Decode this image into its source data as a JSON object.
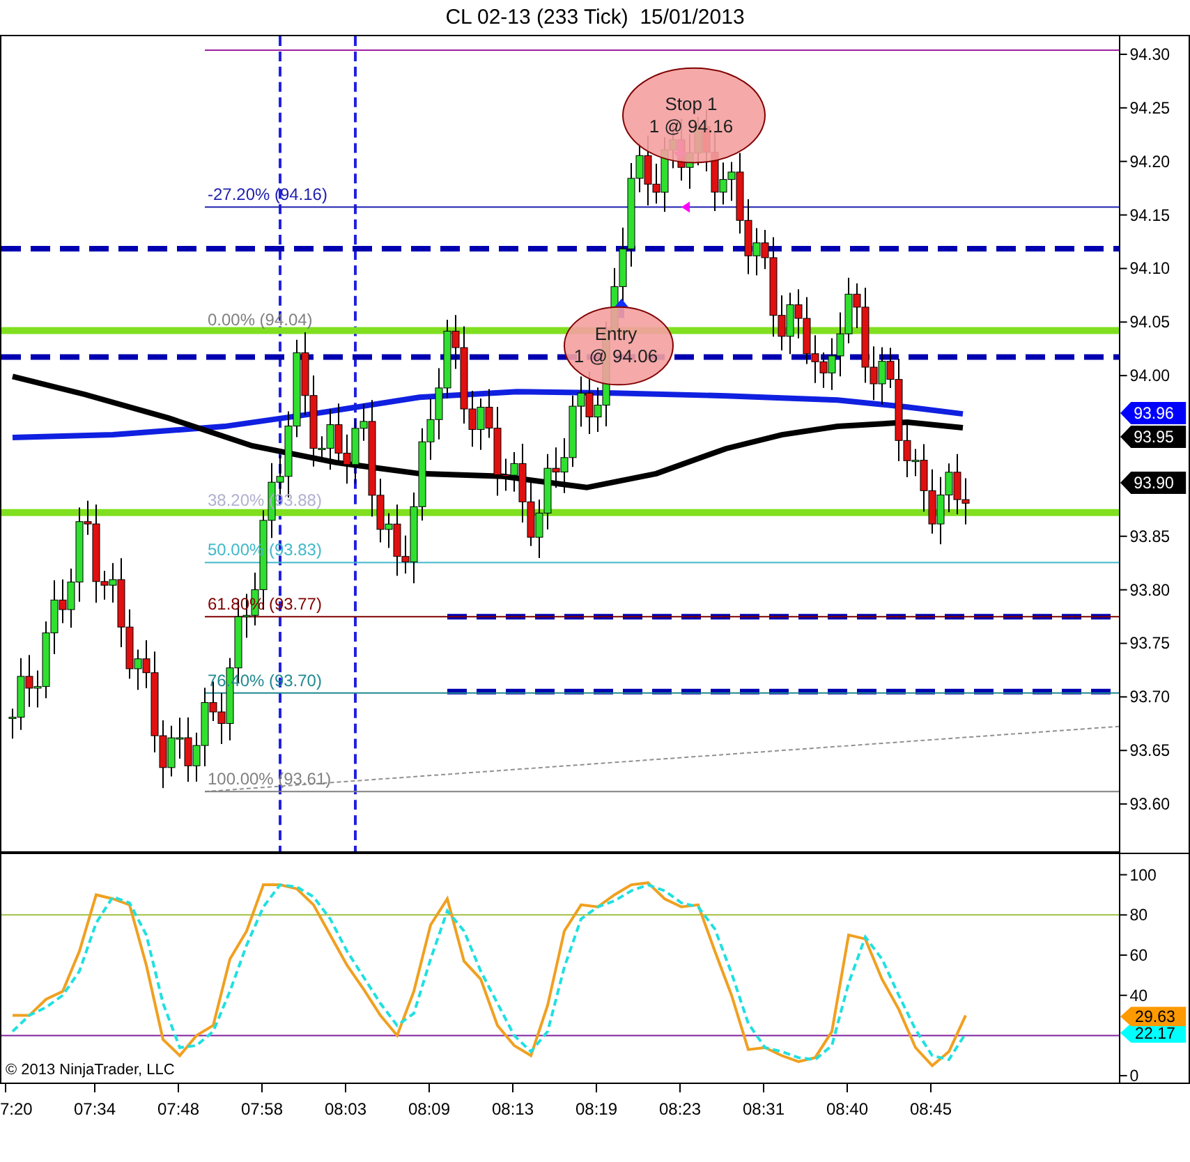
{
  "title": "CL 02-13 (233 Tick)  15/01/2013",
  "price_panel": {
    "price_axis": [
      "94.30",
      "94.25",
      "94.20",
      "94.15",
      "94.10",
      "94.05",
      "94.00",
      "93.85",
      "93.80",
      "93.75",
      "93.70",
      "93.65",
      "93.60"
    ],
    "fib_levels": [
      {
        "label": "-27.20% (94.16)",
        "color": "#2020b0"
      },
      {
        "label": "0.00% (94.04)",
        "color": "#808080"
      },
      {
        "label": "38.20% (93.88)",
        "color": "#b0b0d0"
      },
      {
        "label": "50.00% (93.83)",
        "color": "#40b8c8"
      },
      {
        "label": "61.80% (93.77)",
        "color": "#800000"
      },
      {
        "label": "76.40% (93.70)",
        "color": "#208890"
      },
      {
        "label": "100.00% (93.61)",
        "color": "#808080"
      }
    ],
    "callouts": [
      {
        "kind": "stop",
        "lines": [
          "Stop 1",
          "1 @ 94.16"
        ]
      },
      {
        "kind": "entry",
        "lines": [
          "Entry",
          "1 @ 94.06"
        ]
      }
    ],
    "price_markers": [
      {
        "label": "93.96",
        "color": "#0000ff"
      },
      {
        "label": "93.95",
        "color": "#000000"
      },
      {
        "label": "93.90",
        "color": "#000000"
      }
    ]
  },
  "oscillator_panel": {
    "copyright": "© 2013 NinjaTrader, LLC",
    "markers": [
      {
        "label": "29.63",
        "color": "#ff9900"
      },
      {
        "label": "22.17",
        "color": "#00ffff"
      }
    ],
    "chart_data": {
      "type": "line",
      "ylim": [
        0,
        100
      ],
      "yticks": [
        {
          "value": 0,
          "label": "0"
        },
        {
          "value": 40,
          "label": "40"
        },
        {
          "value": 60,
          "label": "60"
        },
        {
          "value": 80,
          "label": "80"
        },
        {
          "value": 100,
          "label": "100"
        }
      ],
      "ref_lines": [
        {
          "axis": "y",
          "value": 80,
          "color": "#a0c040"
        },
        {
          "axis": "y",
          "value": 20,
          "color": "#8020a0"
        }
      ],
      "series": [
        {
          "color": "#f0a020",
          "line_style": "solid",
          "values": [
            30,
            30,
            38,
            42,
            62,
            90,
            88,
            85,
            55,
            18,
            10,
            20,
            25,
            58,
            72,
            95,
            95,
            93,
            85,
            70,
            55,
            43,
            30,
            20,
            42,
            75,
            88,
            57,
            48,
            25,
            15,
            10,
            35,
            72,
            85,
            84,
            90,
            95,
            96,
            88,
            84,
            85,
            62,
            40,
            13,
            14,
            10,
            7,
            9,
            22,
            70,
            68,
            48,
            33,
            14,
            5,
            12,
            30
          ]
        },
        {
          "color": "#20e0e0",
          "line_style": "dashed",
          "values": [
            22,
            30,
            34,
            40,
            52,
            76,
            89,
            86,
            70,
            36,
            14,
            15,
            22,
            42,
            65,
            84,
            95,
            94,
            89,
            78,
            62,
            49,
            36,
            25,
            31,
            58,
            82,
            72,
            52,
            36,
            20,
            12,
            22,
            54,
            78,
            84,
            87,
            92,
            95,
            92,
            86,
            84,
            73,
            51,
            26,
            14,
            12,
            9,
            8,
            15,
            46,
            69,
            58,
            40,
            23,
            10,
            8,
            21
          ]
        }
      ]
    }
  },
  "time_axis": [
    "7:20",
    "07:34",
    "07:48",
    "07:58",
    "08:03",
    "08:09",
    "08:13",
    "08:19",
    "08:23",
    "08:31",
    "08:40",
    "08:45"
  ]
}
